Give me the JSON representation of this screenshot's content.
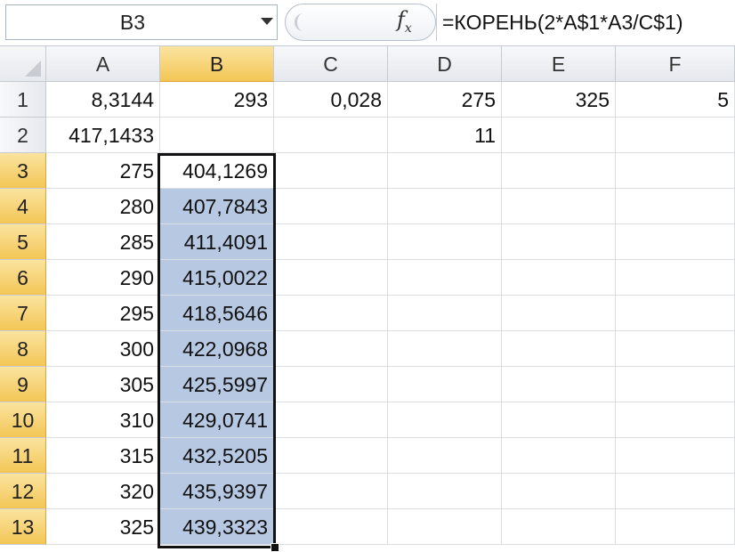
{
  "formula_bar": {
    "name_box": "B3",
    "fx_label": "fx",
    "formula": "=КОРЕНЬ(2*A$1*A3/C$1)"
  },
  "columns": [
    "A",
    "B",
    "C",
    "D",
    "E",
    "F"
  ],
  "selected_column": "B",
  "rows": [
    "1",
    "2",
    "3",
    "4",
    "5",
    "6",
    "7",
    "8",
    "9",
    "10",
    "11",
    "12",
    "13"
  ],
  "selected_rows": [
    "3",
    "4",
    "5",
    "6",
    "7",
    "8",
    "9",
    "10",
    "11",
    "12",
    "13"
  ],
  "cells": {
    "1": {
      "A": "8,3144",
      "B": "293",
      "C": "0,028",
      "D": "275",
      "E": "325",
      "F": "5"
    },
    "2": {
      "A": "417,1433",
      "B": "",
      "C": "",
      "D": "11",
      "E": "",
      "F": ""
    },
    "3": {
      "A": "275",
      "B": "404,1269",
      "C": "",
      "D": "",
      "E": "",
      "F": ""
    },
    "4": {
      "A": "280",
      "B": "407,7843",
      "C": "",
      "D": "",
      "E": "",
      "F": ""
    },
    "5": {
      "A": "285",
      "B": "411,4091",
      "C": "",
      "D": "",
      "E": "",
      "F": ""
    },
    "6": {
      "A": "290",
      "B": "415,0022",
      "C": "",
      "D": "",
      "E": "",
      "F": ""
    },
    "7": {
      "A": "295",
      "B": "418,5646",
      "C": "",
      "D": "",
      "E": "",
      "F": ""
    },
    "8": {
      "A": "300",
      "B": "422,0968",
      "C": "",
      "D": "",
      "E": "",
      "F": ""
    },
    "9": {
      "A": "305",
      "B": "425,5997",
      "C": "",
      "D": "",
      "E": "",
      "F": ""
    },
    "10": {
      "A": "310",
      "B": "429,0741",
      "C": "",
      "D": "",
      "E": "",
      "F": ""
    },
    "11": {
      "A": "315",
      "B": "432,5205",
      "C": "",
      "D": "",
      "E": "",
      "F": ""
    },
    "12": {
      "A": "320",
      "B": "435,9397",
      "C": "",
      "D": "",
      "E": "",
      "F": ""
    },
    "13": {
      "A": "325",
      "B": "439,3323",
      "C": "",
      "D": "",
      "E": "",
      "F": ""
    }
  },
  "colors": {
    "selection_fill": "#b7c8e3",
    "header_selected": "#f3c656"
  }
}
